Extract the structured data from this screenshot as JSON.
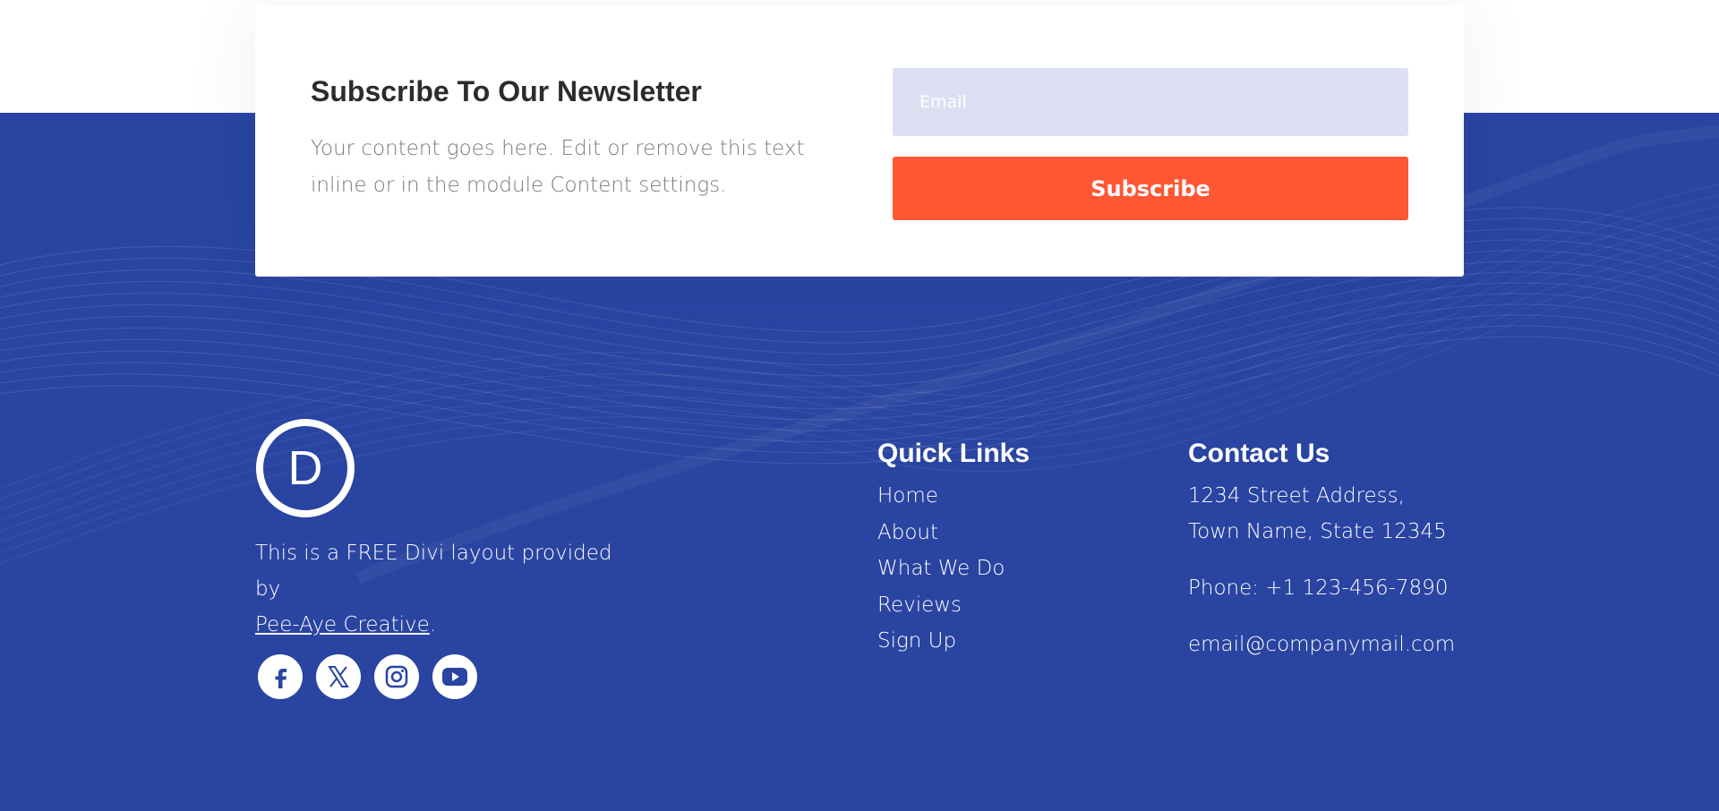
{
  "newsletter": {
    "title": "Subscribe To Our Newsletter",
    "description": "Your content goes here. Edit or remove this text inline or in the module Content settings.",
    "email_placeholder": "Email",
    "subscribe_label": "Subscribe"
  },
  "footer": {
    "logo_letter": "D",
    "about_prefix": "This is a FREE Divi layout provided by",
    "about_link": "Pee-Aye Creative",
    "about_suffix": ".",
    "social_icons": [
      "facebook-icon",
      "x-twitter-icon",
      "instagram-icon",
      "youtube-icon"
    ],
    "quick_links": {
      "title": "Quick Links",
      "items": [
        "Home",
        "About",
        "What We Do",
        "Reviews",
        "Sign Up"
      ]
    },
    "contact": {
      "title": "Contact Us",
      "address_line1": "1234 Street Address,",
      "address_line2": "Town Name, State 12345",
      "phone": "Phone: +1 123-456-7890",
      "email": "email@companymail.com"
    }
  },
  "colors": {
    "footer_bg": "#2944a1",
    "accent": "#ff5733",
    "input_bg": "#dce0f2",
    "heading": "#2c2c2c"
  }
}
